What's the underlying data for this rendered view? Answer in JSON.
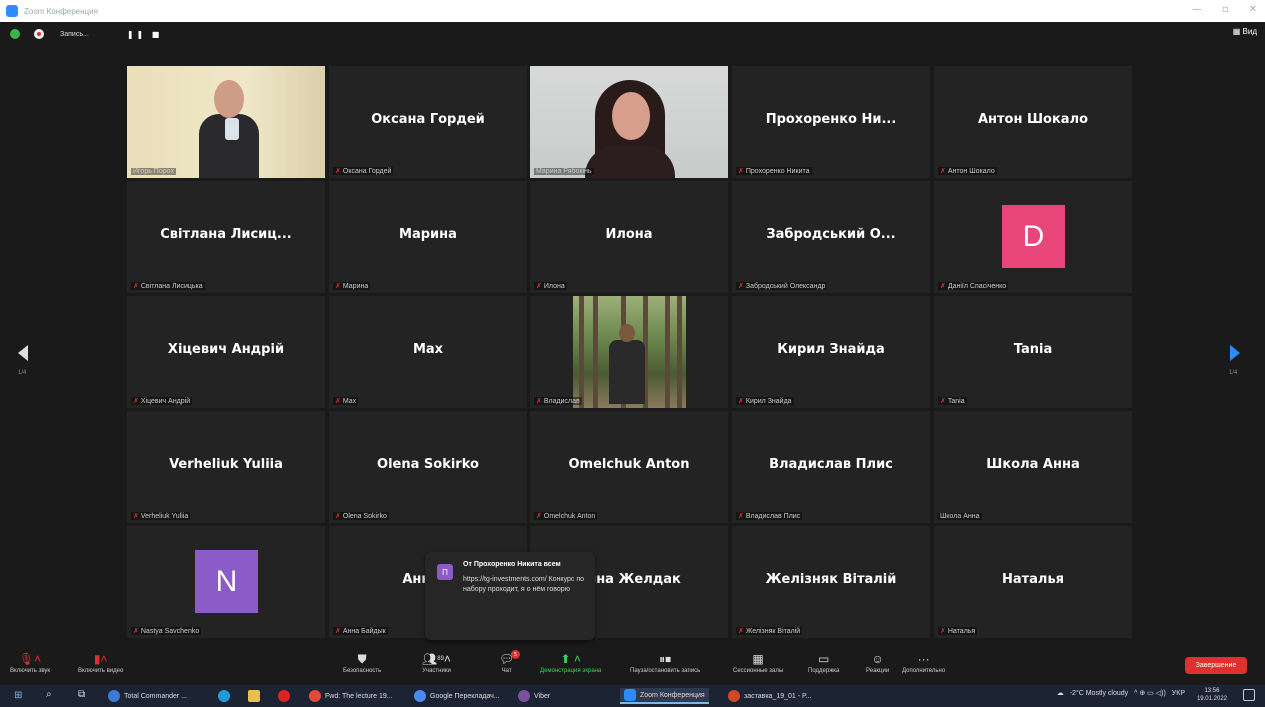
{
  "window": {
    "title": "Zoom Конференция"
  },
  "topbar": {
    "recording_label": "Запись...",
    "view_label": "Вид"
  },
  "tiles": [
    {
      "name": "",
      "label": "Игорь Порох",
      "muted": false,
      "video": "video1"
    },
    {
      "name": "Оксана Гордей",
      "label": "Оксана Гордей",
      "muted": true
    },
    {
      "name": "",
      "label": "Марина Рябокінь",
      "muted": false,
      "video": "video2",
      "active": true
    },
    {
      "name": "Прохоренко Ни...",
      "label": "Прохоренко Никита",
      "muted": true
    },
    {
      "name": "Антон Шокало",
      "label": "Антон Шокало",
      "muted": true
    },
    {
      "name": "Світлана Лисиц...",
      "label": "Світлана Лисицька",
      "muted": true
    },
    {
      "name": "Марина",
      "label": "Марина",
      "muted": true
    },
    {
      "name": "Илона",
      "label": "Илона",
      "muted": true
    },
    {
      "name": "Забродський О...",
      "label": "Забродський Олександр",
      "muted": true
    },
    {
      "name": "",
      "label": "Даніїл Спасіченко",
      "muted": true,
      "avatar": "D"
    },
    {
      "name": "Хіцевич Андрій",
      "label": "Хіцевич Андрій",
      "muted": true
    },
    {
      "name": "Max",
      "label": "Max",
      "muted": true
    },
    {
      "name": "",
      "label": "Владислав",
      "muted": true,
      "video": "video3"
    },
    {
      "name": "Кирил Знайда",
      "label": "Кирил Знайда",
      "muted": true
    },
    {
      "name": "Tania",
      "label": "Tania",
      "muted": true
    },
    {
      "name": "Verheliuk Yuliia",
      "label": "Verheliuk Yuliia",
      "muted": true
    },
    {
      "name": "Olena Sokirko",
      "label": "Olena Sokirko",
      "muted": true
    },
    {
      "name": "Omelchuk Anton",
      "label": "Omelchuk Anton",
      "muted": true
    },
    {
      "name": "Владислав Плис",
      "label": "Владислав Плис",
      "muted": true
    },
    {
      "name": "Школа Анна",
      "label": "Школа Анна",
      "muted": false
    },
    {
      "name": "",
      "label": "Nastya Savchenko",
      "muted": true,
      "avatar": "N"
    },
    {
      "name": "Анна Б",
      "label": "Анна Байдык",
      "muted": true
    },
    {
      "name": "Анна Желдак",
      "label": "",
      "muted": false
    },
    {
      "name": "Желізняк Віталій",
      "label": "Желізняк Віталій",
      "muted": true
    },
    {
      "name": "Наталья",
      "label": "Наталья",
      "muted": true
    }
  ],
  "pager": {
    "left": "1/4",
    "right": "1/4"
  },
  "chat_popup": {
    "avatar_letter": "П",
    "from": "От Прохоренко Никита всем",
    "message": "https://tg-investments.com/ Конкурс по набору проходит, я о нём говорю"
  },
  "toolbar": {
    "unmute": "Включить звук",
    "start_video": "Включить видео",
    "security": "Безопасность",
    "participants": "Участники",
    "participants_count": "89",
    "chat": "Чат",
    "chat_badge": "5",
    "share": "Демонстрация экрана",
    "pause_record": "Пауза/остановить запись",
    "breakout": "Сессионные залы",
    "support": "Поддержка",
    "reactions": "Реакции",
    "more": "Дополнительно",
    "end": "Завершение"
  },
  "taskbar": {
    "items": [
      "Total Commander ...",
      "Fwd: The lecture 19...",
      "Google Перекладач...",
      "Viber",
      "Zoom Конференция",
      "заставка_19_01 - P..."
    ],
    "weather": "-2°C  Mostly cloudy",
    "lang": "УКР",
    "time": "13:56",
    "date": "19.01.2022"
  },
  "colors": {
    "accent": "#2d8cff",
    "end": "#e02f2f",
    "active_speaker": "#b7dd52",
    "avatar_d": "#e8457a",
    "avatar_n": "#8b5bc7"
  }
}
